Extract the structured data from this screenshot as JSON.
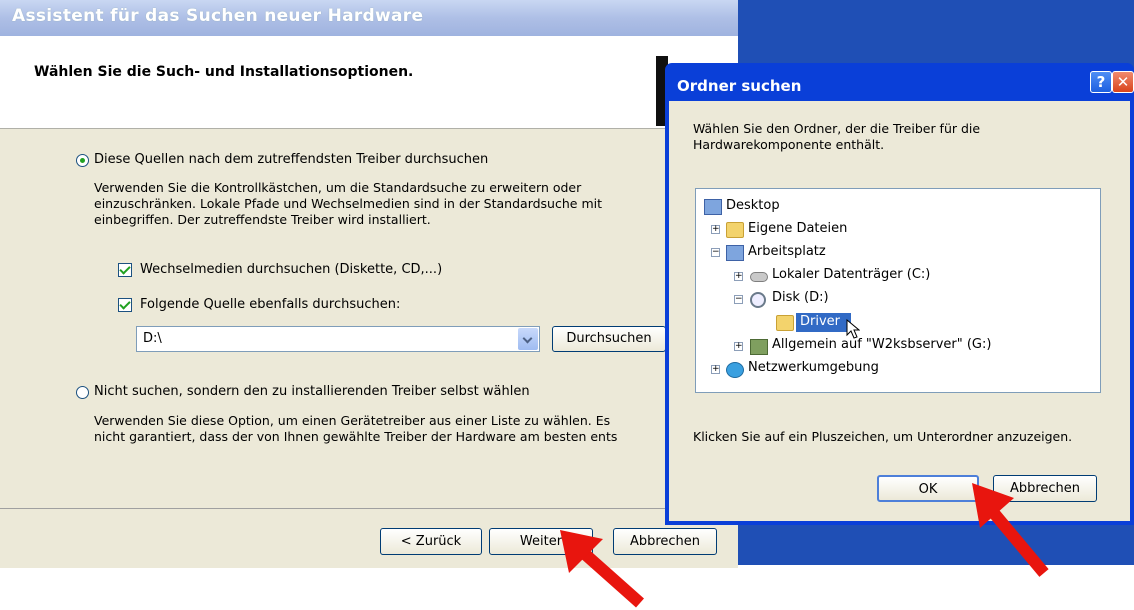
{
  "wizard": {
    "title": "Assistent für das Suchen neuer Hardware",
    "heading": "Wählen Sie die Such- und Installationsoptionen.",
    "option_search": {
      "label": "Diese Quellen nach dem zutreffendsten Treiber durchsuchen",
      "selected": true,
      "description_lines": [
        "Verwenden Sie die Kontrollkästchen, um die Standardsuche zu erweitern oder",
        "einzuschränken. Lokale Pfade und Wechselmedien sind in der Standardsuche mit",
        "einbegriffen. Der zutreffendste Treiber wird installiert."
      ]
    },
    "checkbox_removable": {
      "label": "Wechselmedien durchsuchen (Diskette, CD,...)",
      "checked": true
    },
    "checkbox_source": {
      "label": "Folgende Quelle ebenfalls durchsuchen:",
      "checked": true
    },
    "path_value": "D:\\",
    "browse_button": "Durchsuchen",
    "option_manual": {
      "label": "Nicht suchen, sondern den zu installierenden Treiber selbst wählen",
      "selected": false,
      "description_lines": [
        "Verwenden Sie diese Option, um einen Gerätetreiber aus einer Liste zu wählen. Es",
        "nicht garantiert, dass der von Ihnen gewählte Treiber der Hardware am besten ents"
      ]
    },
    "back_button": "< Zurück",
    "next_button": "Weiter",
    "cancel_button": "Abbrechen"
  },
  "dialog": {
    "title": "Ordner suchen",
    "help_glyph": "?",
    "close_glyph": "✕",
    "instruction_lines": [
      "Wählen Sie den Ordner, der die Treiber für die",
      "Hardwarekomponente enthält."
    ],
    "tree": [
      {
        "label": "Desktop",
        "icon": "desktop-icon"
      },
      {
        "label": "Eigene Dateien",
        "icon": "folder-icon",
        "expander": "+"
      },
      {
        "label": "Arbeitsplatz",
        "icon": "computer-icon",
        "expander": "−"
      },
      {
        "label": "Lokaler Datenträger (C:)",
        "icon": "drive-icon",
        "expander": "+"
      },
      {
        "label": "Disk (D:)",
        "icon": "cd-icon",
        "expander": "−"
      },
      {
        "label": "Driver",
        "icon": "folder-open-icon",
        "selected": true
      },
      {
        "label": "Allgemein auf \"W2ksbserver\" (G:)",
        "icon": "network-drive-icon",
        "expander": "+"
      },
      {
        "label": "Netzwerkumgebung",
        "icon": "network-icon",
        "expander": "+"
      }
    ],
    "hint": "Klicken Sie auf ein Pluszeichen, um Unterordner anzuzeigen.",
    "ok_button": "OK",
    "cancel_button": "Abbrechen"
  },
  "colors": {
    "annotation_arrow": "#e8150e",
    "title_bar_dialog": "#0a3fd8",
    "desktop": "#1f4fb5"
  }
}
